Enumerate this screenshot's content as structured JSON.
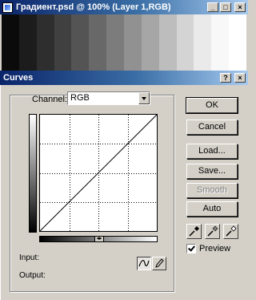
{
  "document_window": {
    "title": "Градиент.psd @ 100% (Layer 1,RGB)",
    "controls": [
      "minimize",
      "maximize",
      "close"
    ],
    "gradient_steps": [
      "#0b0b0b",
      "#1c1c1c",
      "#2e2e2e",
      "#404040",
      "#545454",
      "#686868",
      "#7c7c7c",
      "#919191",
      "#a6a6a6",
      "#bdbdbd",
      "#d4d4d4",
      "#eaeaea",
      "#f8f8f8",
      "#ffffff"
    ]
  },
  "dialog": {
    "title": "Curves",
    "channel_label": "Channel:",
    "channel_value": "RGB",
    "input_label": "Input:",
    "output_label": "Output:",
    "buttons": {
      "ok": "OK",
      "cancel": "Cancel",
      "load": "Load...",
      "save": "Save...",
      "smooth": "Smooth",
      "auto": "Auto"
    },
    "preview_label": "Preview",
    "preview_checked": true,
    "eyedroppers": [
      "black-eyedropper-icon",
      "gray-eyedropper-icon",
      "white-eyedropper-icon"
    ],
    "tools": [
      "curve-tool-icon",
      "pencil-tool-icon"
    ],
    "curve_points": [
      [
        0,
        0
      ],
      [
        255,
        255
      ]
    ],
    "grid_divisions": 4
  }
}
